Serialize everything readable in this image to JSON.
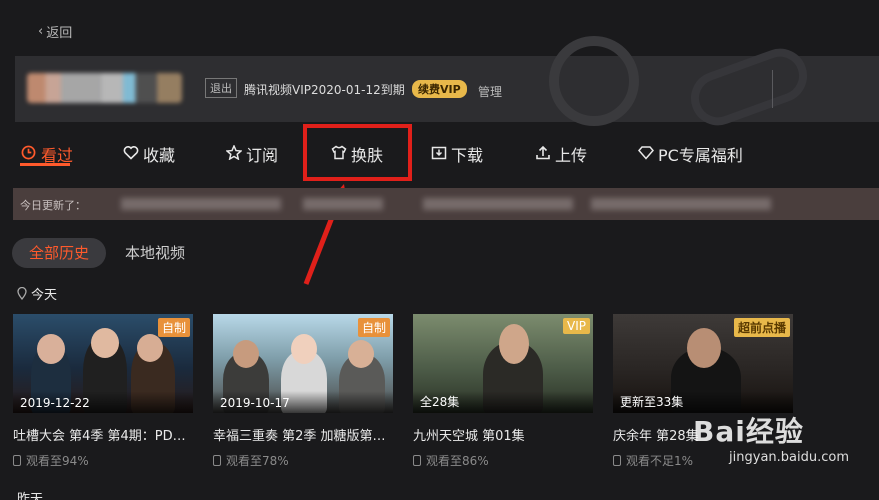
{
  "header": {
    "back_label": "返回"
  },
  "account": {
    "logout_label": "退出",
    "vip_expiry": "腾讯视频VIP2020-01-12到期",
    "renew_label": "续费VIP",
    "manage_label": "管理"
  },
  "tabs": [
    {
      "label": "看过",
      "icon": "clock-icon",
      "active": true
    },
    {
      "label": "收藏",
      "icon": "heart-icon"
    },
    {
      "label": "订阅",
      "icon": "star-icon"
    },
    {
      "label": "换肤",
      "icon": "shirt-icon"
    },
    {
      "label": "下载",
      "icon": "download-icon"
    },
    {
      "label": "上传",
      "icon": "upload-icon"
    },
    {
      "label": "PC专属福利",
      "icon": "diamond-icon"
    }
  ],
  "update_bar": {
    "label": "今日更新了："
  },
  "subtabs": [
    {
      "label": "全部历史",
      "active": true
    },
    {
      "label": "本地视频"
    }
  ],
  "sections": {
    "today": "今天",
    "yesterday": "昨天"
  },
  "cards": [
    {
      "badge": "自制",
      "thumb_text": "2019-12-22",
      "title": "吐槽大会 第4季 第4期：PDD…",
      "progress": "观看至94%"
    },
    {
      "badge": "自制",
      "thumb_text": "2019-10-17",
      "title": "幸福三重奏 第2季 加糖版第1…",
      "progress": "观看至78%"
    },
    {
      "badge": "VIP",
      "thumb_text": "全28集",
      "title": "九州天空城 第01集",
      "progress": "观看至86%"
    },
    {
      "badge": "超前点播",
      "thumb_text": "更新至33集",
      "title": "庆余年 第28集",
      "progress": "观看不足1%"
    }
  ],
  "watermark": {
    "brand": "Bai经验",
    "url": "jingyan.baidu.com"
  },
  "colors": {
    "accent": "#ff5a2c",
    "vip_gold": "#e8b84a",
    "highlight_red": "#e0201a"
  }
}
